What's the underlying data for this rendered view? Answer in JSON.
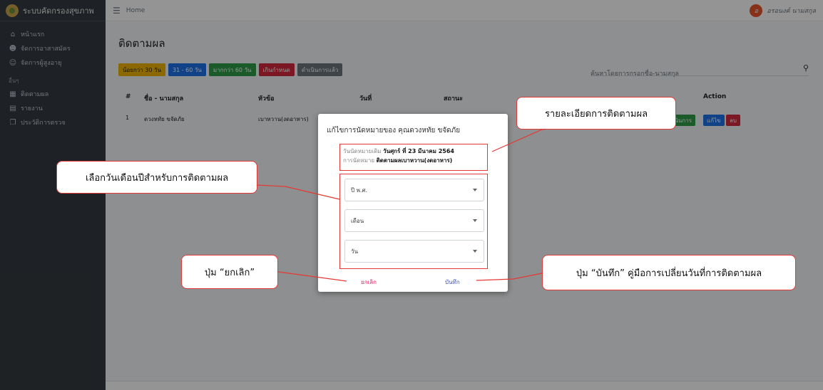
{
  "sidebar": {
    "brand": "ระบบคัดกรองสุขภาพ",
    "items": [
      {
        "icon": "home-icon",
        "glyph": "⌂",
        "label": "หน้าแรก"
      },
      {
        "icon": "users-icon",
        "glyph": "☻",
        "label": "จัดการอาสาสมัคร"
      },
      {
        "icon": "group-icon",
        "glyph": "☺",
        "label": "จัดการผู้สูงอายุ"
      }
    ],
    "section": "อื่นๆ",
    "items2": [
      {
        "icon": "calendar-icon",
        "glyph": "▦",
        "label": "ติดตามผล"
      },
      {
        "icon": "file-icon",
        "glyph": "▤",
        "label": "รายงาน"
      },
      {
        "icon": "copy-icon",
        "glyph": "❐",
        "label": "ประวัติการตรวจ"
      }
    ]
  },
  "topbar": {
    "home": "Home",
    "avatar_letter": "อ",
    "user_name": "อรอนงค์ นามสกุล"
  },
  "page": {
    "title": "ติดตามผล",
    "filters": [
      {
        "label": "น้อยกว่า 30 วัน",
        "color": "#f0b400"
      },
      {
        "label": "31 - 60 วัน",
        "color": "#1e73e8"
      },
      {
        "label": "มากกว่า 60 วัน",
        "color": "#2e9e48"
      },
      {
        "label": "เกินกำหนด",
        "color": "#d6293e"
      },
      {
        "label": "ดำเนินการแล้ว",
        "color": "#6c757d"
      }
    ],
    "search_placeholder": "ค้นหาโดยการกรอกชื่อ-นามสกุล",
    "columns": [
      "#",
      "ชื่อ - นามสกุล",
      "หัวข้อ",
      "วันที่",
      "สถานะ",
      "Action"
    ],
    "row": {
      "num": "1",
      "name": "ดวงหทัย ขจัดภัย",
      "topic": "เบาหวาน(งดอาหาร)"
    },
    "actions": [
      "ดำเนินการ",
      "แก้ไข",
      "ลบ"
    ]
  },
  "modal": {
    "title": "แก้ไขการนัดหมายของ คุณดวงหทัย ขจัดภัย",
    "old_date_label": "วันนัดหมายเดิม",
    "old_date_value": "วันศุกร์ ที่ 23 มีนาคม 2564",
    "appt_label": "การนัดหมาย",
    "appt_value": "ติดตามผลเบาหวาน(งดอาหาร)",
    "select_year": "ปี พ.ศ.",
    "select_month": "เดือน",
    "select_day": "วัน",
    "cancel": "ยกเลิก",
    "save": "บันทึก"
  },
  "callouts": {
    "details": "รายละเอียดการติดตามผล",
    "choose_date": "เลือกวันเดือนปีสำหรับการติดตามผล",
    "cancel_btn": "ปุ่ม “ยกเลิก”",
    "save_btn": "ปุ่ม “บันทึก” คู่มือการเปลี่ยนวันที่การติดตามผล"
  }
}
